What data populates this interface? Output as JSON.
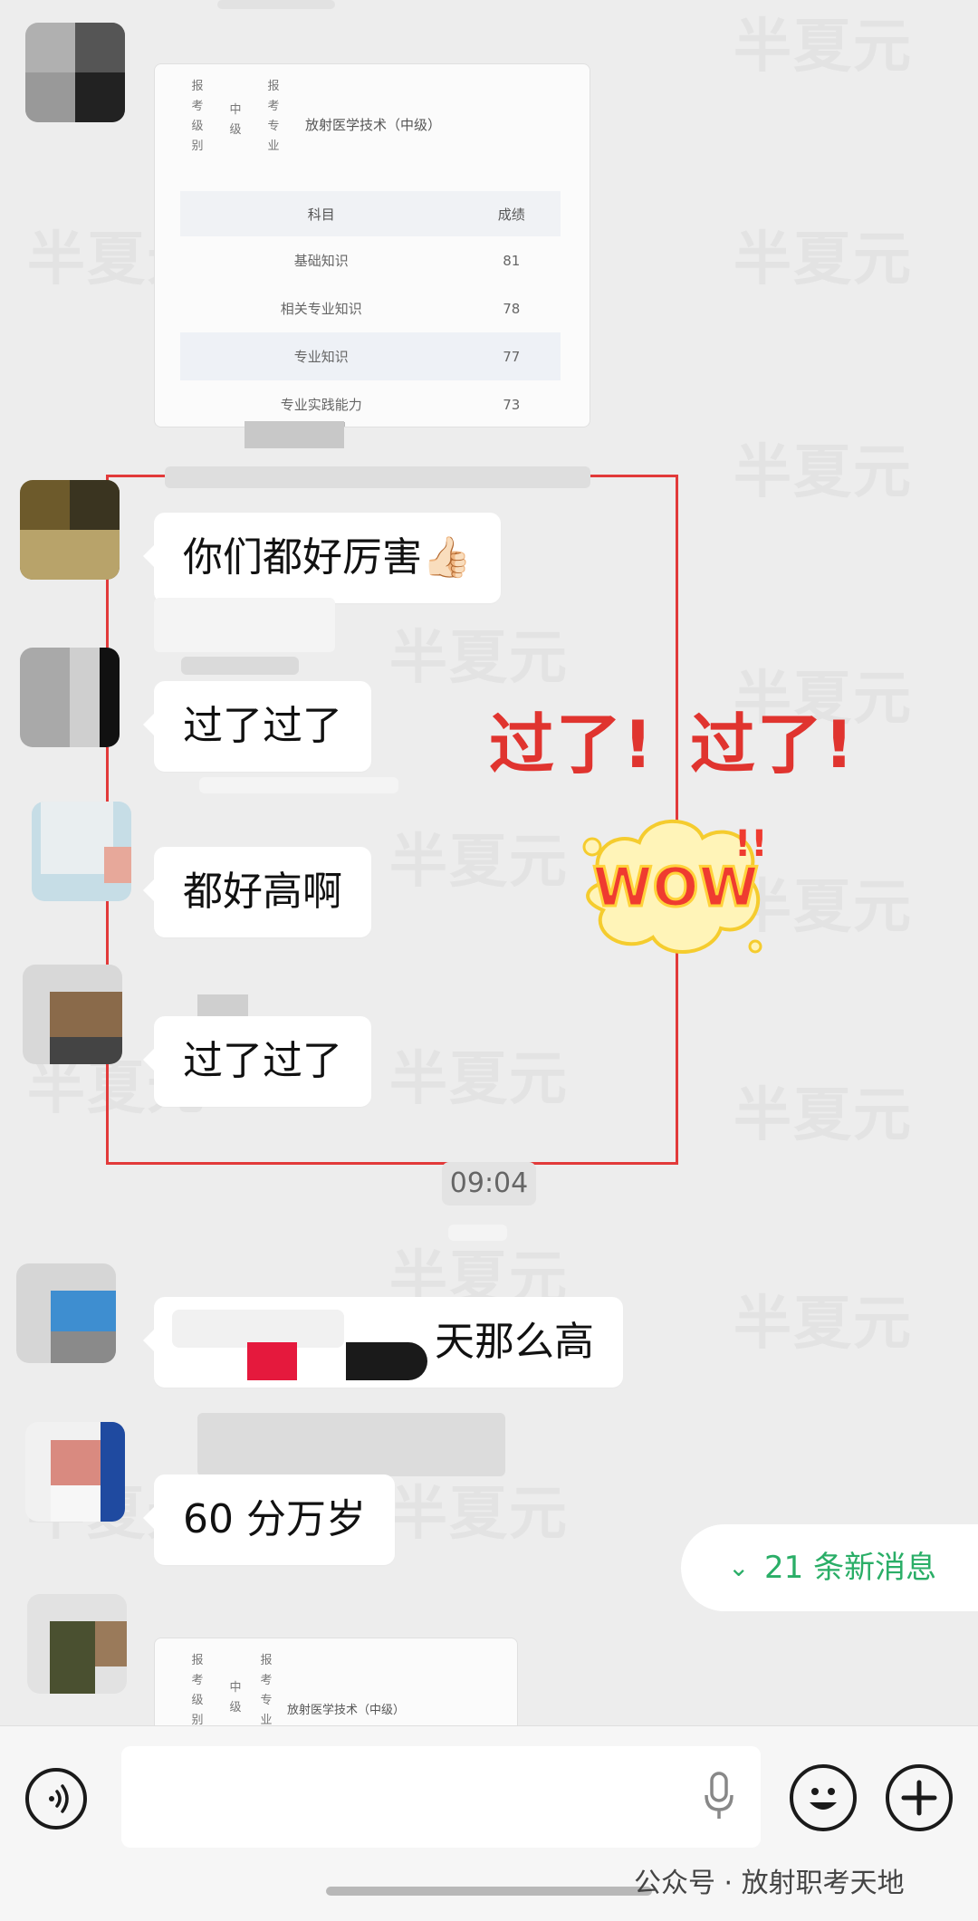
{
  "watermark": "半夏元",
  "cards": {
    "top": {
      "meta1": "报考级别",
      "meta1_value": "中级",
      "meta2": "报考专业",
      "specialty": "放射医学技术（中级）",
      "table": {
        "headers": [
          "科目",
          "成绩"
        ],
        "rows": [
          {
            "subject": "基础知识",
            "score": "81"
          },
          {
            "subject": "相关专业知识",
            "score": "78"
          },
          {
            "subject": "专业知识",
            "score": "77"
          },
          {
            "subject": "专业实践能力",
            "score": "73"
          }
        ]
      }
    },
    "bottom": {
      "meta1": "报考级别",
      "meta1_value": "中级",
      "meta2": "报考专业",
      "specialty": "放射医学技术（中级）"
    }
  },
  "messages": [
    {
      "text": "你们都好厉害👍🏻"
    },
    {
      "text": "过了过了"
    },
    {
      "text": "都好高啊"
    },
    {
      "text": "过了过了"
    },
    {
      "text": "天那么高"
    },
    {
      "text": "60 分万岁"
    }
  ],
  "annotation": {
    "text1": "过了!",
    "text2": "过了!",
    "sticker": "WOW",
    "sticker_marks": "!!"
  },
  "timestamp": "09:04",
  "new_messages": {
    "icon": "double-chevron-down-icon",
    "label": "21 条新消息"
  },
  "input_bar": {
    "voice_icon": "voice-icon",
    "mic_icon": "microphone-icon",
    "emoji_icon": "emoji-icon",
    "plus_icon": "plus-icon"
  },
  "account_label": "公众号 · 放射职考天地",
  "colors": {
    "accent_green": "#2aae67",
    "annotation_red": "#e0342f",
    "bubble": "#ffffff",
    "chat_bg": "#ededed"
  }
}
